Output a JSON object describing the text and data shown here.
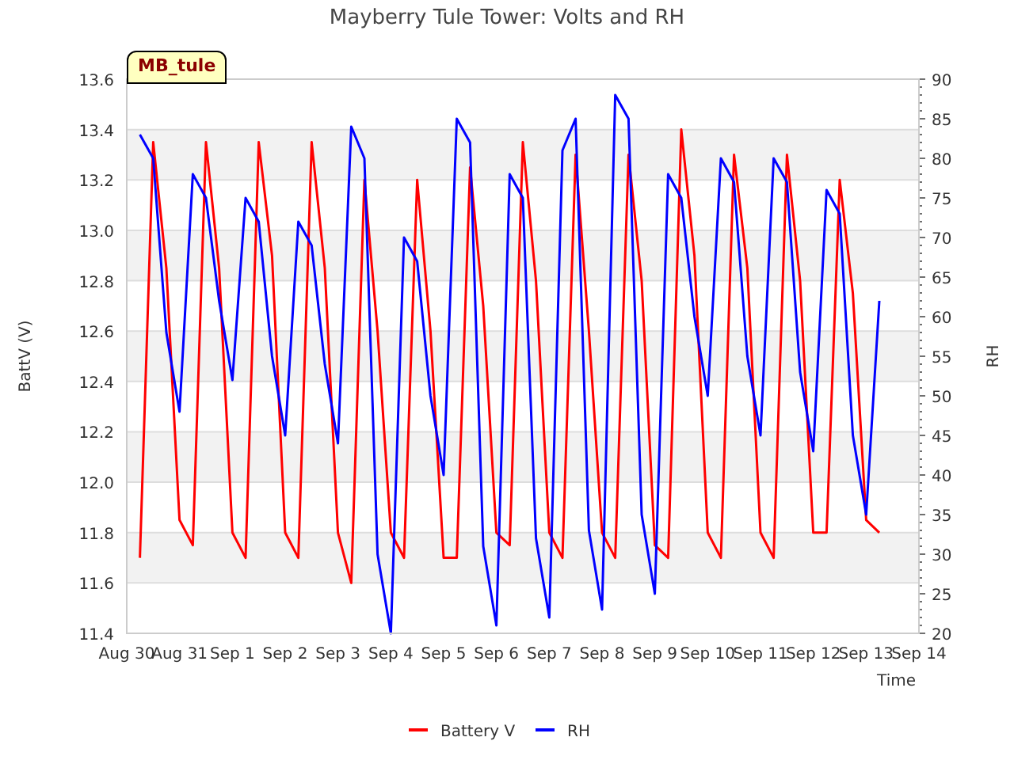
{
  "title": "Mayberry Tule Tower: Volts and RH",
  "badge": "MB_tule",
  "chart_data": {
    "type": "line",
    "grid": true,
    "legend": "bottom",
    "xlabel": "Time",
    "ylabel": "BattV (V)",
    "ylim": [
      11.4,
      13.6
    ],
    "yticks": [
      {
        "value": 11.4,
        "label": "11.4"
      },
      {
        "value": 11.6,
        "label": "11.6"
      },
      {
        "value": 11.8,
        "label": "11.8"
      },
      {
        "value": 12.0,
        "label": "12.0"
      },
      {
        "value": 12.2,
        "label": "12.2"
      },
      {
        "value": 12.4,
        "label": "12.4"
      },
      {
        "value": 12.6,
        "label": "12.6"
      },
      {
        "value": 12.8,
        "label": "12.8"
      },
      {
        "value": 13.0,
        "label": "13.0"
      },
      {
        "value": 13.2,
        "label": "13.2"
      },
      {
        "value": 13.4,
        "label": "13.4"
      },
      {
        "value": 13.6,
        "label": "13.6"
      }
    ],
    "y2label": "RH",
    "y2lim": [
      20,
      90
    ],
    "y2ticks": [
      {
        "value": 90,
        "label": "90"
      },
      {
        "value": 85,
        "label": "85"
      },
      {
        "value": 80,
        "label": "80"
      },
      {
        "value": 75,
        "label": "75"
      },
      {
        "value": 70,
        "label": "70"
      },
      {
        "value": 65,
        "label": "65"
      },
      {
        "value": 60,
        "label": "60"
      },
      {
        "value": 55,
        "label": "55"
      },
      {
        "value": 50,
        "label": "50"
      },
      {
        "value": 45,
        "label": "45"
      },
      {
        "value": 40,
        "label": "40"
      },
      {
        "value": 35,
        "label": "35"
      },
      {
        "value": 30,
        "label": "30"
      },
      {
        "value": 25,
        "label": "25"
      },
      {
        "value": 20,
        "label": "20"
      }
    ],
    "categories": [
      "Aug 30",
      null,
      null,
      null,
      "Aug 31",
      null,
      null,
      null,
      "Sep 1",
      null,
      null,
      null,
      "Sep 2",
      null,
      null,
      null,
      "Sep 3",
      null,
      null,
      null,
      "Sep 4",
      null,
      null,
      null,
      "Sep 5",
      null,
      null,
      null,
      "Sep 6",
      null,
      null,
      null,
      "Sep 7",
      null,
      null,
      null,
      "Sep 8",
      null,
      null,
      null,
      "Sep 9",
      null,
      null,
      null,
      "Sep 10",
      null,
      null,
      null,
      "Sep 11",
      null,
      null,
      null,
      "Sep 12",
      null,
      null,
      null,
      "Sep 13",
      null,
      null,
      null,
      "Sep 14"
    ],
    "series": [
      {
        "name": "Battery V",
        "color": "#ff0000",
        "values": [
          null,
          11.7,
          13.35,
          12.85,
          11.85,
          11.75,
          13.35,
          12.85,
          11.8,
          11.7,
          13.35,
          12.9,
          11.8,
          11.7,
          13.35,
          12.85,
          11.8,
          11.6,
          13.2,
          12.6,
          11.8,
          11.7,
          13.2,
          12.6,
          11.7,
          11.7,
          13.25,
          12.7,
          11.8,
          11.75,
          13.35,
          12.8,
          11.8,
          11.7,
          13.3,
          12.6,
          11.8,
          11.7,
          13.3,
          12.8,
          11.75,
          11.7,
          13.4,
          12.9,
          11.8,
          11.7,
          13.3,
          12.85,
          11.8,
          11.7,
          13.3,
          12.8,
          11.8,
          11.8,
          13.2,
          12.75,
          11.85,
          11.8,
          null,
          null,
          null
        ]
      },
      {
        "name": "RH",
        "color": "#0000ff",
        "axis": "y2",
        "values": [
          null,
          83,
          80,
          58,
          48,
          78,
          75,
          62,
          52,
          75,
          72,
          55,
          45,
          72,
          69,
          54,
          44,
          84,
          80,
          30,
          20,
          70,
          67,
          50,
          40,
          85,
          82,
          31,
          21,
          78,
          75,
          32,
          22,
          81,
          85,
          33,
          23,
          88,
          85,
          35,
          25,
          78,
          75,
          60,
          50,
          80,
          77,
          55,
          45,
          80,
          77,
          53,
          43,
          76,
          73,
          45,
          35,
          62,
          null,
          null,
          null
        ]
      }
    ]
  }
}
